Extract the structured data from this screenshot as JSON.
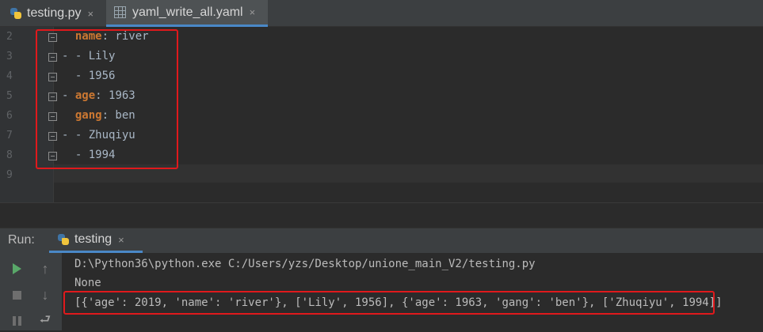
{
  "tabs": [
    {
      "label": "testing.py",
      "icon": "python-file-icon",
      "close": "×"
    },
    {
      "label": "yaml_write_all.yaml",
      "icon": "yaml-file-icon",
      "close": "×",
      "active": true
    }
  ],
  "editor": {
    "lines": [
      {
        "num": "2",
        "prefix": "  ",
        "key": "name",
        "rest": ": river"
      },
      {
        "num": "3",
        "prefix": "- - Lily",
        "key": "",
        "rest": ""
      },
      {
        "num": "4",
        "prefix": "  - 1956",
        "key": "",
        "rest": ""
      },
      {
        "num": "5",
        "prefix": "- ",
        "key": "age",
        "rest": ": 1963"
      },
      {
        "num": "6",
        "prefix": "  ",
        "key": "gang",
        "rest": ": ben"
      },
      {
        "num": "7",
        "prefix": "- - Zhuqiyu",
        "key": "",
        "rest": ""
      },
      {
        "num": "8",
        "prefix": "  - 1994",
        "key": "",
        "rest": ""
      },
      {
        "num": "9",
        "prefix": "",
        "key": "",
        "rest": ""
      }
    ]
  },
  "run": {
    "label": "Run:",
    "tab_label": "testing",
    "tab_close": "×",
    "output": [
      "D:\\Python36\\python.exe C:/Users/yzs/Desktop/unione_main_V2/testing.py",
      "None",
      "[{'age': 2019, 'name': 'river'}, ['Lily', 1956], {'age': 1963, 'gang': 'ben'}, ['Zhuqiyu', 1994]]"
    ]
  },
  "colors": {
    "key": "#cc7832",
    "highlight_box": "#e0191c",
    "accent": "#4a88c7"
  }
}
